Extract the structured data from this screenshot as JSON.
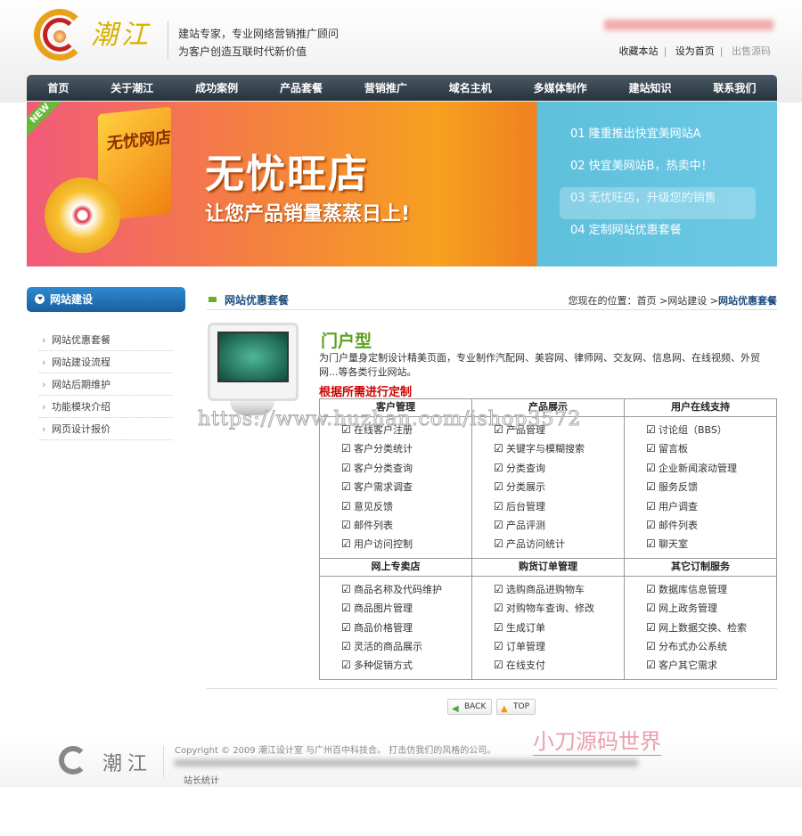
{
  "header": {
    "logo_text": "潮江",
    "slogan_line1": "建站专家，专业网络营销推广顾问",
    "slogan_line2": "为客户创造互联时代新价值",
    "links": [
      "收藏本站",
      "设为首页",
      "出售源码"
    ]
  },
  "nav": [
    "首页",
    "关于潮江",
    "成功案例",
    "产品套餐",
    "营销推广",
    "域名主机",
    "多媒体制作",
    "建站知识",
    "联系我们"
  ],
  "banner": {
    "new_tag": "NEW",
    "box_text": "无忧网店",
    "title": "无忧旺店",
    "subtitle": "让您产品销量蒸蒸日上!",
    "items": [
      "01  隆重推出快宜美网站A",
      "02  快宜美网站B，热卖中！",
      "03  无忧旺店，升级您的销售",
      "04  定制网站优惠套餐"
    ],
    "active_index": 2
  },
  "sidebar": {
    "title": "网站建设",
    "items": [
      "网站优惠套餐",
      "网站建设流程",
      "网站后期维护",
      "功能模块介绍",
      "网页设计报价"
    ]
  },
  "main": {
    "section_title": "网站优惠套餐",
    "breadcrumb": {
      "prefix": "您现在的位置：",
      "path": "首页 >网站建设 >",
      "current": "网站优惠套餐"
    },
    "product_title": "门户型",
    "description": "为门户量身定制设计精美页面，专业制作汽配网、美容网、律师网、交友网、信息网、在线视频、外贸网...等各类行业网站。",
    "custom_note": "根据所需进行定制",
    "table": [
      {
        "headers": [
          "客户管理",
          "产品展示",
          "用户在线支持"
        ],
        "columns": [
          [
            "在线客户注册",
            "客户分类统计",
            "客户分类查询",
            "客户需求调查",
            "意见反馈",
            "邮件列表",
            "用户访问控制"
          ],
          [
            "产品管理",
            "关键字与模糊搜索",
            "分类查询",
            "分类展示",
            "后台管理",
            "产品评测",
            "产品访问统计"
          ],
          [
            "讨论组（BBS）",
            "留言板",
            "企业新闻滚动管理",
            "服务反馈",
            "用户调查",
            "邮件列表",
            "聊天室"
          ]
        ]
      },
      {
        "headers": [
          "网上专卖店",
          "购货订单管理",
          "其它订制服务"
        ],
        "columns": [
          [
            "商品名称及代码维护",
            "商品图片管理",
            "商品价格管理",
            "灵活的商品展示",
            "多种促销方式"
          ],
          [
            "选购商品进购物车",
            "对购物车查询、修改",
            "生成订单",
            "订单管理",
            "在线支付"
          ],
          [
            "数据库信息管理",
            "网上政务管理",
            "网上数据交换、检索",
            "分布式办公系统",
            "客户其它需求"
          ]
        ]
      }
    ],
    "back_label": "BACK",
    "top_label": "TOP"
  },
  "footer": {
    "logo_text": "潮江",
    "copyright": "Copyright © 2009 潮江设计室  与广州百中科技合。  打击仿我们的风格的公司。",
    "stats": "站长统计"
  },
  "watermarks": {
    "url": "https://www.huzhan.com/ishop3572",
    "brand": "小刀源码世界"
  },
  "colors": {
    "nav": "#26333c",
    "accent_blue": "#1a5f9e",
    "title_green": "#5aa020",
    "note_red": "#cc0000"
  }
}
